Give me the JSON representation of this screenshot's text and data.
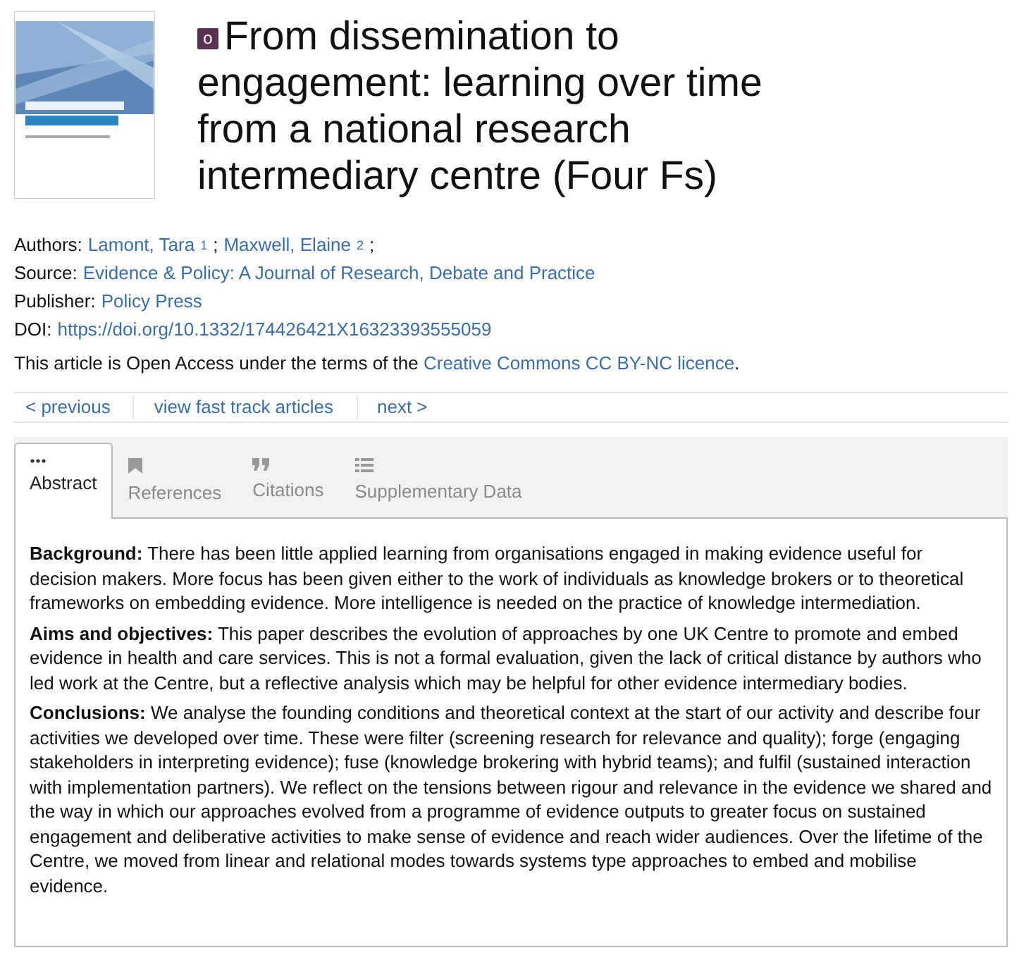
{
  "article": {
    "badge": "o",
    "title": "From dissemination to engagement: learning over time from a national research intermediary centre (Four Fs)"
  },
  "metadata": [
    {
      "label": "Authors:",
      "kind": "authors",
      "authors": [
        {
          "name": "Lamont, Tara",
          "sup": "1",
          "sep": ";"
        },
        {
          "name": "Maxwell, Elaine",
          "sup": "2",
          "sep": ";"
        }
      ]
    },
    {
      "label": "Source:",
      "kind": "link",
      "value": "Evidence & Policy: A Journal of Research, Debate and Practice"
    },
    {
      "label": "Publisher:",
      "kind": "link",
      "value": "Policy Press"
    },
    {
      "label": "DOI:",
      "kind": "link",
      "value": "https://doi.org/10.1332/174426421X16323393555059"
    }
  ],
  "access_note": {
    "text": "This article is Open Access under the terms of the",
    "link": "Creative Commons CC BY-NC licence",
    "end": "."
  },
  "nav": [
    "< previous",
    "view fast track articles",
    "next >"
  ],
  "tabs": [
    {
      "label": "Abstract",
      "selected": true
    },
    {
      "label": "References",
      "selected": false
    },
    {
      "label": "Citations",
      "selected": false
    },
    {
      "label": "Supplementary Data",
      "selected": false
    }
  ],
  "abstract": [
    {
      "heading": "Background:",
      "text": "There has been little applied learning from organisations engaged in making evidence useful for decision makers. More focus has been given either to the work of individuals as knowledge brokers or to theoretical frameworks on embedding evidence. More intelligence is needed on the practice of knowledge intermediation."
    },
    {
      "heading": "Aims and objectives:",
      "text": "This paper describes the evolution of approaches by one UK Centre to promote and embed evidence in health and care services. This is not a formal evaluation, given the lack of critical distance by authors who led work at the Centre, but a reflective analysis which may be helpful for other evidence intermediary bodies."
    },
    {
      "heading": "Conclusions:",
      "text": "We analyse the founding conditions and theoretical context at the start of our activity and describe four activities we developed over time. These were filter (screening research for relevance and quality); forge (engaging stakeholders in interpreting evidence); fuse (knowledge brokering with hybrid teams); and fulfil (sustained interaction with implementation partners). We reflect on the tensions between rigour and relevance in the evidence we shared and the way in which our approaches evolved from a programme of evidence outputs to greater focus on sustained engagement and deliberative activities to make sense of evidence and reach wider audiences. Over the lifetime of the Centre, we moved from linear and relational modes towards systems type approaches to embed and mobilise evidence."
    }
  ]
}
